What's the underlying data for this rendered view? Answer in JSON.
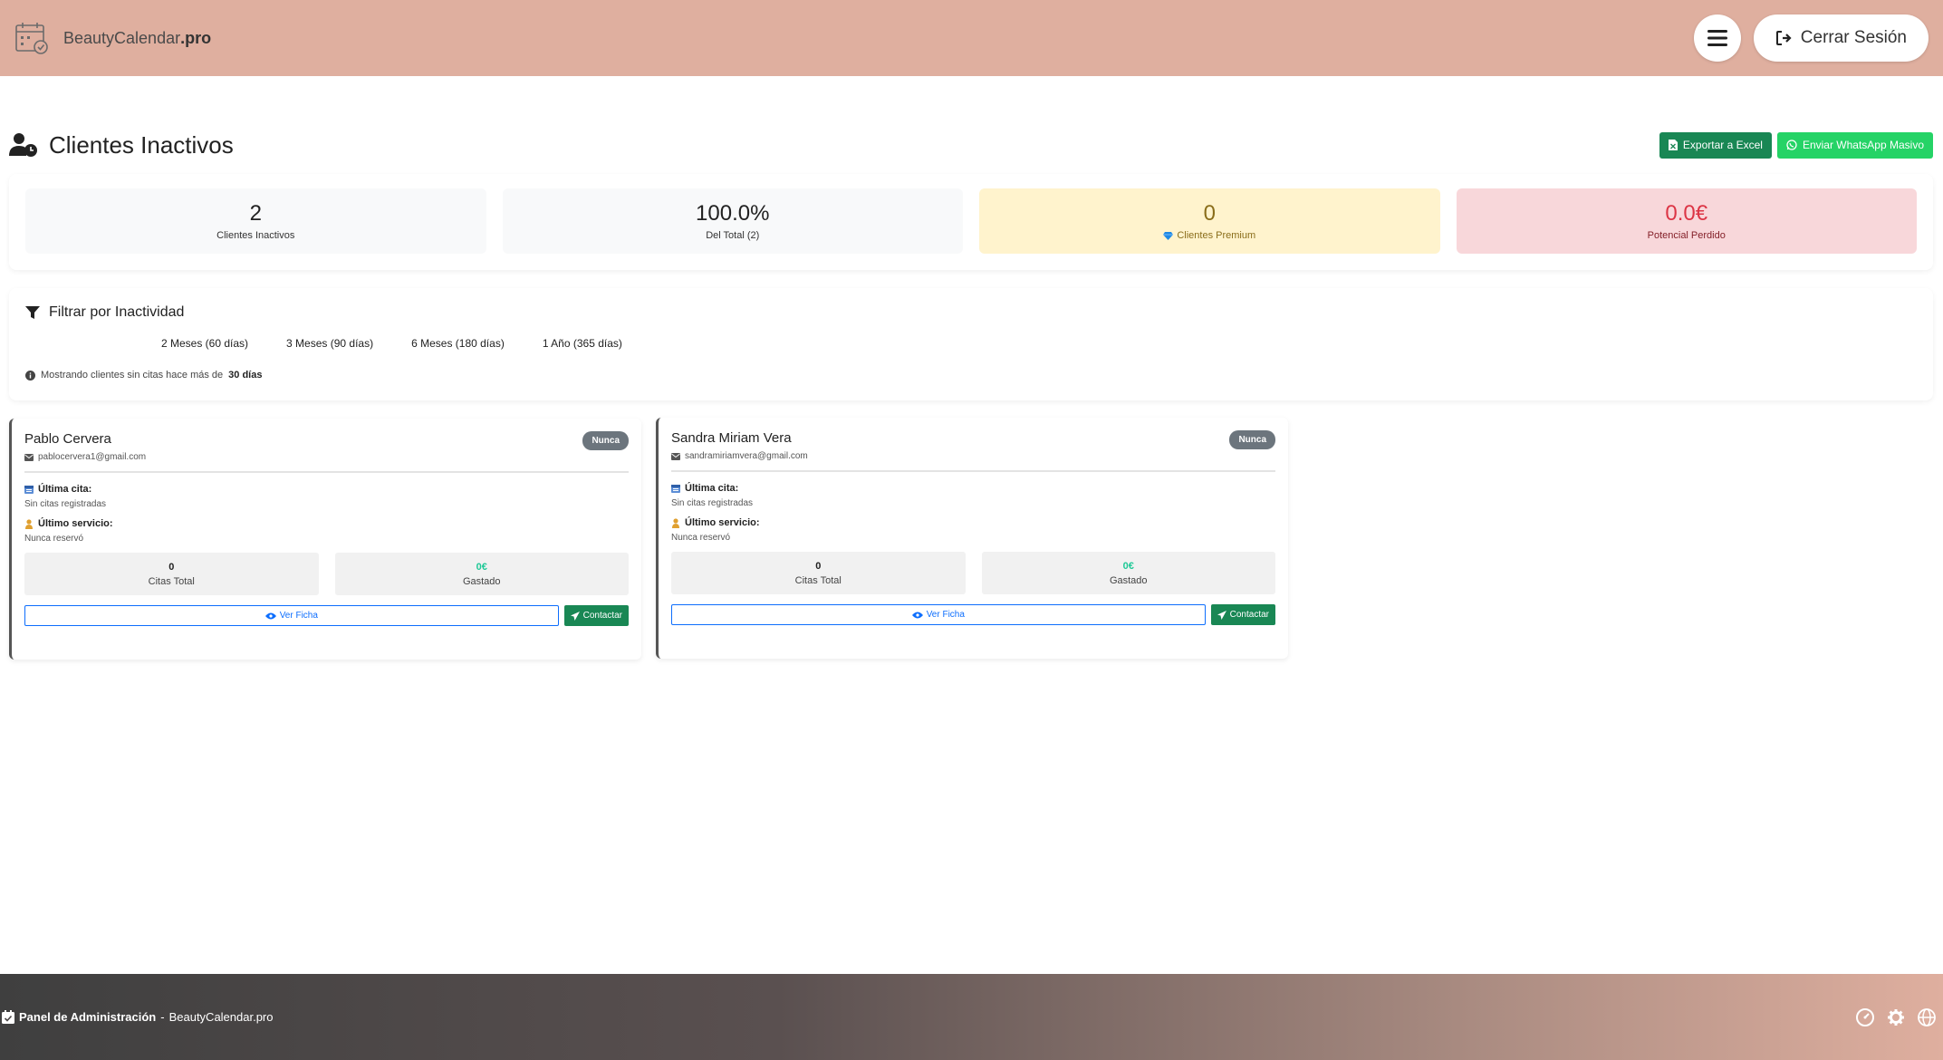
{
  "brand": {
    "name": "BeautyCalendar",
    "suffix": ".pro"
  },
  "nav": {
    "logout_label": "Cerrar Sesión"
  },
  "page": {
    "title": "Clientes Inactivos"
  },
  "actions": {
    "export_label": "Exportar a Excel",
    "whatsapp_label": "Enviar WhatsApp Masivo"
  },
  "stats": [
    {
      "value": "2",
      "label": "Clientes Inactivos"
    },
    {
      "value": "100.0%",
      "label": "Del Total (2)"
    },
    {
      "value": "0",
      "label": "Clientes Premium"
    },
    {
      "value": "0.0€",
      "label": "Potencial Perdido"
    }
  ],
  "filter": {
    "title": "Filtrar por Inactividad",
    "options": [
      "2 Meses (60 días)",
      "3 Meses (90 días)",
      "6 Meses (180 días)",
      "1 Año (365 días)"
    ],
    "note_prefix": "Mostrando clientes sin citas hace más de",
    "note_value": "30 días"
  },
  "labels": {
    "last_appointment": "Última cita:",
    "last_service": "Último servicio:",
    "total_appointments": "Citas Total",
    "spent": "Gastado",
    "view": "Ver Ficha",
    "contact": "Contactar"
  },
  "clients": [
    {
      "name": "Pablo Cervera",
      "email": "pablocervera1@gmail.com",
      "badge": "Nunca",
      "last_appointment": "Sin citas registradas",
      "last_service": "Nunca reservó",
      "appointments": "0",
      "spent": "0€"
    },
    {
      "name": "Sandra Miriam Vera",
      "email": "sandramiriamvera@gmail.com",
      "badge": "Nunca",
      "last_appointment": "Sin citas registradas",
      "last_service": "Nunca reservó",
      "appointments": "0",
      "spent": "0€"
    }
  ],
  "footer": {
    "title": "Panel de Administración",
    "separator": " - ",
    "brand": "BeautyCalendar.pro"
  }
}
